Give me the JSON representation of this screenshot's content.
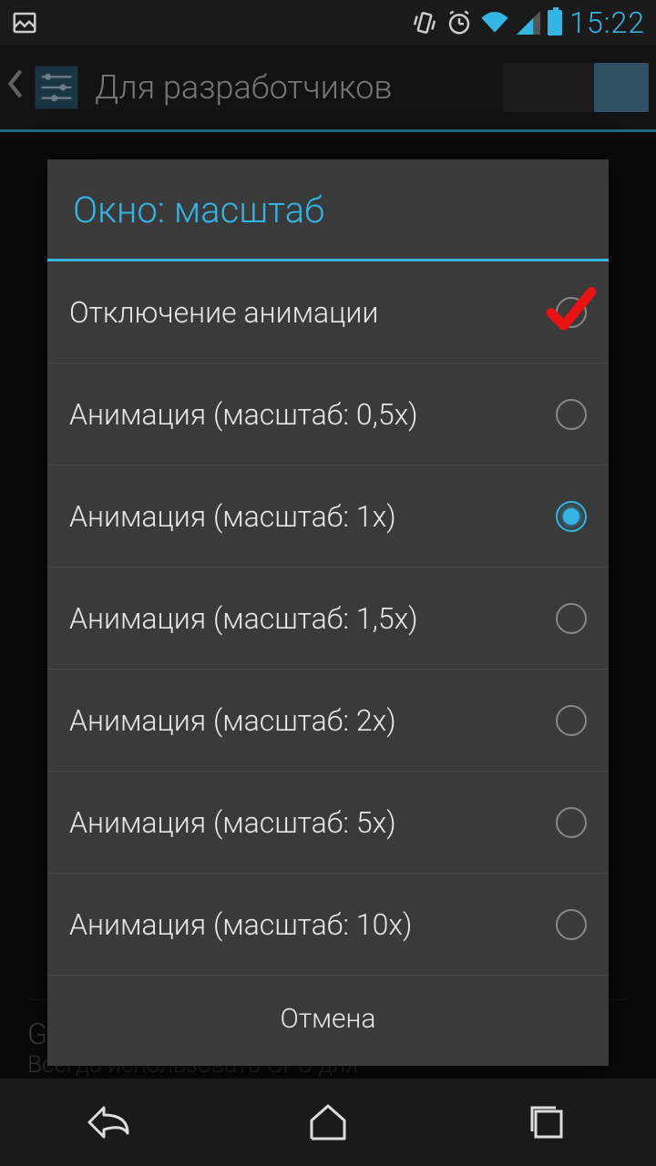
{
  "status": {
    "time": "15:22"
  },
  "action_bar": {
    "title": "Для разработчиков"
  },
  "dialog": {
    "title": "Окно: масштаб",
    "options": [
      {
        "label": "Отключение анимации",
        "selected": false,
        "annotated": true
      },
      {
        "label": "Анимация (масштаб: 0,5x)",
        "selected": false
      },
      {
        "label": "Анимация (масштаб: 1x)",
        "selected": true
      },
      {
        "label": "Анимация (масштаб: 1,5x)",
        "selected": false
      },
      {
        "label": "Анимация (масштаб: 2x)",
        "selected": false
      },
      {
        "label": "Анимация (масштаб: 5x)",
        "selected": false
      },
      {
        "label": "Анимация (масштаб: 10x)",
        "selected": false
      }
    ],
    "cancel": "Отмена"
  },
  "background": {
    "item_title": "GPU-ускорение",
    "item_sub": "Всегда использовать GPU для"
  }
}
